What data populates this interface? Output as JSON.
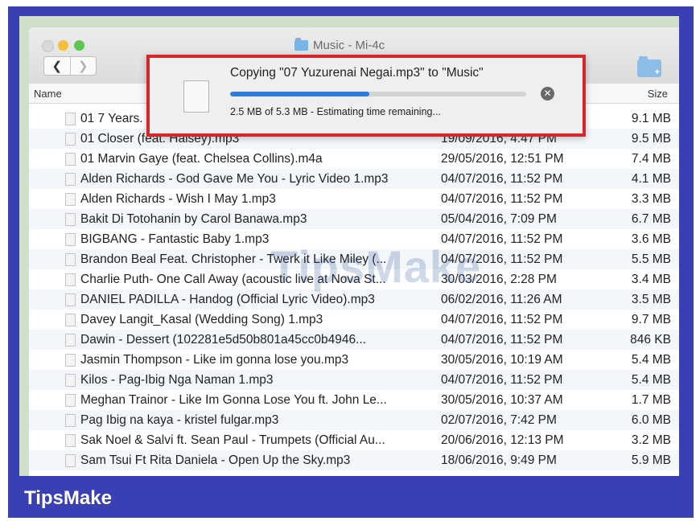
{
  "window": {
    "title": "Music - Mi-4c",
    "back_label": "❮",
    "forward_label": "❯",
    "new_folder_glyph": "+"
  },
  "columns": {
    "name": "Name",
    "size": "Size"
  },
  "files": [
    {
      "name": "01 7 Years.",
      "date": "",
      "size": "9.1 MB"
    },
    {
      "name": "01 Closer (feat. Halsey).mp3",
      "date": "19/09/2016, 4:47 PM",
      "size": "9.5 MB"
    },
    {
      "name": "01 Marvin Gaye (feat. Chelsea Collins).m4a",
      "date": "29/05/2016, 12:51 PM",
      "size": "7.4 MB"
    },
    {
      "name": "Alden Richards - God Gave Me You - Lyric Video 1.mp3",
      "date": "04/07/2016, 11:52 PM",
      "size": "4.1 MB"
    },
    {
      "name": "Alden Richards - Wish I May 1.mp3",
      "date": "04/07/2016, 11:52 PM",
      "size": "3.3 MB"
    },
    {
      "name": "Bakit Di Totohanin by Carol Banawa.mp3",
      "date": "05/04/2016, 7:09 PM",
      "size": "6.7 MB"
    },
    {
      "name": "BIGBANG - Fantastic Baby 1.mp3",
      "date": "04/07/2016, 11:52 PM",
      "size": "3.6 MB"
    },
    {
      "name": "Brandon Beal Feat. Christopher - Twerk it Like Miley (...",
      "date": "04/07/2016, 11:52 PM",
      "size": "5.5 MB"
    },
    {
      "name": "Charlie Puth- One Call Away (acoustic live at Nova St...",
      "date": "30/03/2016, 2:28 PM",
      "size": "3.4 MB"
    },
    {
      "name": "DANIEL PADILLA - Handog (Official Lyric Video).mp3",
      "date": "06/02/2016, 11:26 AM",
      "size": "3.5 MB"
    },
    {
      "name": "Davey Langit_Kasal (Wedding Song) 1.mp3",
      "date": "04/07/2016, 11:52 PM",
      "size": "9.7 MB"
    },
    {
      "name": "Dawin - Dessert (102281e5d50b801a45cc0b4946...",
      "date": "04/07/2016, 11:52 PM",
      "size": "846 KB"
    },
    {
      "name": "Jasmin Thompson - Like im gonna lose you.mp3",
      "date": "30/05/2016, 10:19 AM",
      "size": "5.4 MB"
    },
    {
      "name": "Kilos - Pag-Ibig Nga Naman 1.mp3",
      "date": "04/07/2016, 11:52 PM",
      "size": "5.4 MB"
    },
    {
      "name": "Meghan Trainor - Like Im Gonna Lose You ft. John Le...",
      "date": "30/05/2016, 10:37 AM",
      "size": "1.7 MB"
    },
    {
      "name": "Pag Ibig na kaya - kristel fulgar.mp3",
      "date": "02/07/2016, 7:42 PM",
      "size": "6.0 MB"
    },
    {
      "name": "Sak Noel & Salvi ft. Sean Paul - Trumpets (Official Au...",
      "date": "20/06/2016, 12:13 PM",
      "size": "3.2 MB"
    },
    {
      "name": "Sam Tsui Ft Rita Daniela - Open Up the Sky.mp3",
      "date": "18/06/2016, 9:49 PM",
      "size": "5.9 MB"
    }
  ],
  "copy_dialog": {
    "title": "Copying \"07 Yuzurenai Negai.mp3\" to \"Music\"",
    "status": "2.5 MB of 5.3 MB - Estimating time remaining...",
    "progress_fraction": 0.47,
    "stop_glyph": "✕"
  },
  "watermark": "TipsMake",
  "brand": "TipsMake",
  "colors": {
    "frame": "#3a3fb4",
    "dialog_highlight": "#d7262b",
    "progress": "#2e7bd8"
  }
}
